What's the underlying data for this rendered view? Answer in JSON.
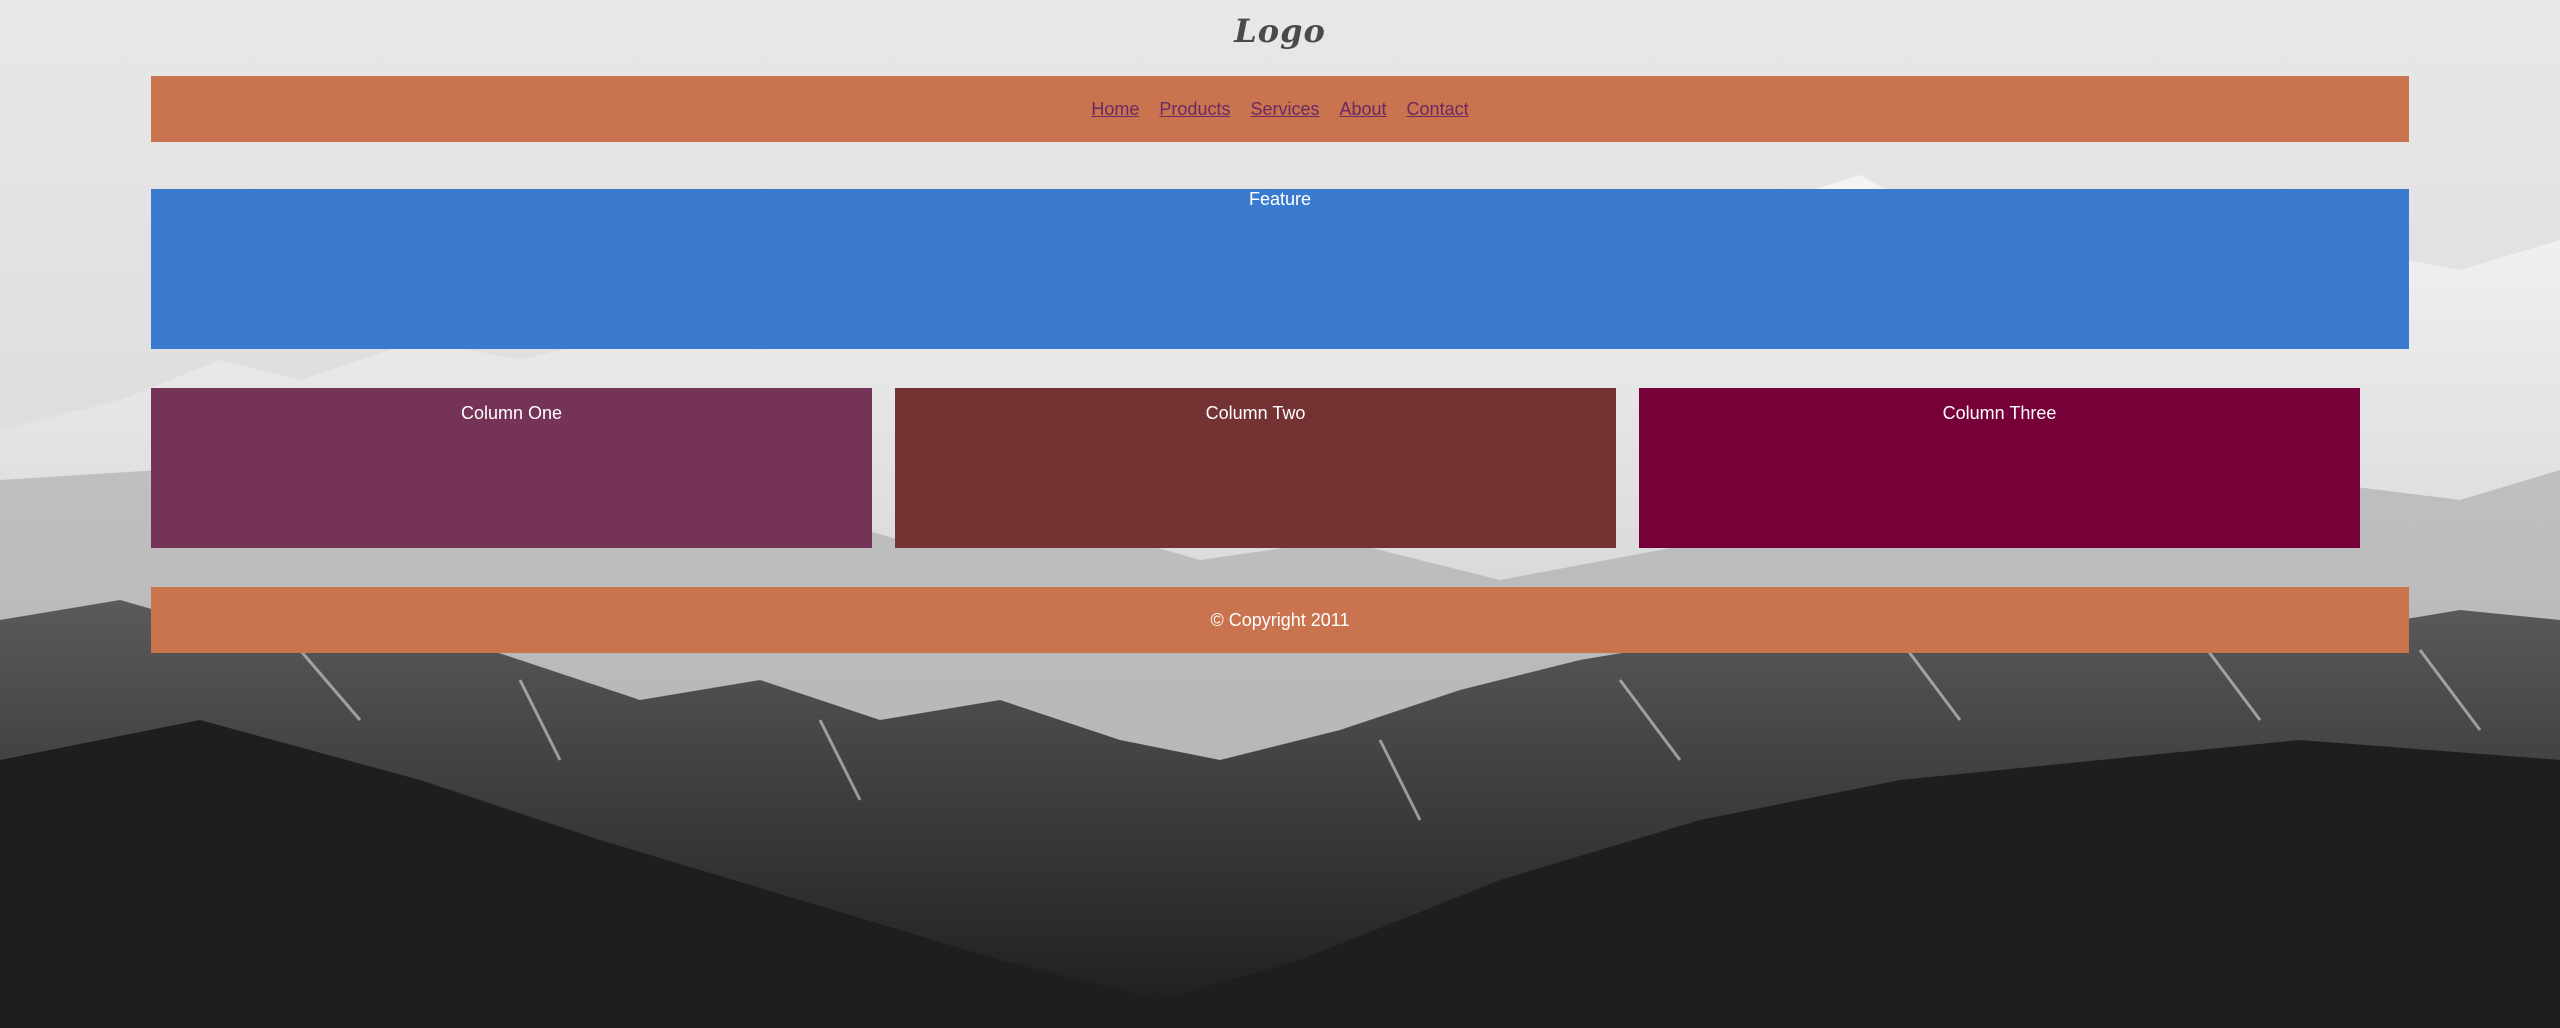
{
  "header": {
    "logo_text": "Logo"
  },
  "nav": {
    "items": [
      {
        "label": "Home"
      },
      {
        "label": "Products"
      },
      {
        "label": "Services"
      },
      {
        "label": "About"
      },
      {
        "label": "Contact"
      }
    ]
  },
  "feature": {
    "label": "Feature"
  },
  "columns": [
    {
      "label": "Column One",
      "color": "#743357"
    },
    {
      "label": "Column Two",
      "color": "#743233"
    },
    {
      "label": "Column Three",
      "color": "#760038"
    }
  ],
  "footer": {
    "copyright": "© Copyright 2011"
  },
  "colors": {
    "nav_bg": "#c9734f",
    "feature_bg": "#3a7bcf",
    "link": "#6b2a63"
  },
  "background": {
    "icon": "mountain-landscape-image"
  }
}
